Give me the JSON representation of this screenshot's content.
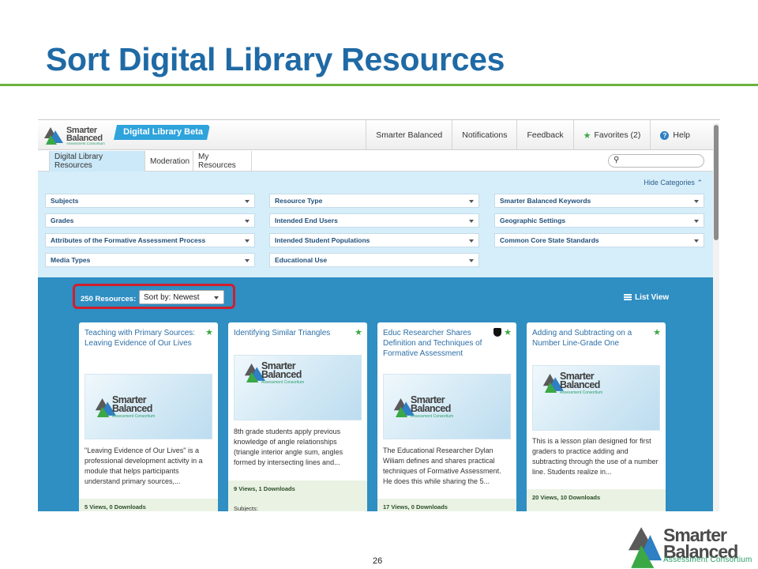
{
  "slide": {
    "title": "Sort Digital Library Resources",
    "page_number": "26"
  },
  "app": {
    "logo_line1": "Smarter",
    "logo_line2": "Balanced",
    "logo_sub": "Assessment Consortium",
    "app_tab": "Digital Library Beta",
    "nav": [
      "Smarter Balanced",
      "Notifications",
      "Feedback",
      "Favorites (2)",
      "Help"
    ],
    "tabs": [
      "Digital Library Resources",
      "Moderation",
      "My Resources"
    ],
    "active_tab": "Digital Library Resources",
    "search": {
      "placeholder": ""
    }
  },
  "filters": {
    "hide_label": "Hide Categories",
    "col1": [
      "Subjects",
      "Grades",
      "Attributes of the Formative Assessment Process",
      "Media Types"
    ],
    "col2": [
      "Resource Type",
      "Intended End Users",
      "Intended Student Populations",
      "Educational Use"
    ],
    "col3": [
      "Smarter Balanced Keywords",
      "Geographic Settings",
      "Common Core State Standards"
    ]
  },
  "results": {
    "count_label": "250 Resources:",
    "sort_label": "Sort by: Newest",
    "list_view_label": "List View",
    "cards": [
      {
        "title": "Teaching with Primary Sources: Leaving Evidence of Our Lives",
        "desc": "\"Leaving Evidence of Our Lives\" is a professional development activity in a module that helps participants understand primary sources,...",
        "stats": "5 Views, 0 Downloads",
        "subjects": ""
      },
      {
        "title": "Identifying Similar Triangles",
        "desc": "8th grade students apply previous knowledge of angle relationships (triangle interior angle sum, angles formed by intersecting lines and...",
        "stats": "9 Views, 1 Downloads",
        "subjects": "Subjects:"
      },
      {
        "title": "Educ Researcher Shares Definition and Techniques of Formative Assessment",
        "desc": "The Educational Researcher Dylan Wiliam defines and shares practical techniques of Formative Assessment. He does this while sharing the 5...",
        "stats": "17 Views, 0 Downloads",
        "subjects": ""
      },
      {
        "title": "Adding and Subtracting on a Number Line-Grade One",
        "desc": "This is a lesson plan designed for first graders to practice adding and subtracting through the use of a number line. Students realize in...",
        "stats": "20 Views, 10 Downloads",
        "subjects": ""
      }
    ]
  },
  "brand": {
    "line1": "Smarter",
    "line2": "Balanced",
    "sub": "Assessment Consortium"
  },
  "colors": {
    "title_blue": "#1f6aa5",
    "rule_green": "#6ab23e",
    "results_blue": "#2f8ec2",
    "highlight_red": "#d21e2c"
  }
}
